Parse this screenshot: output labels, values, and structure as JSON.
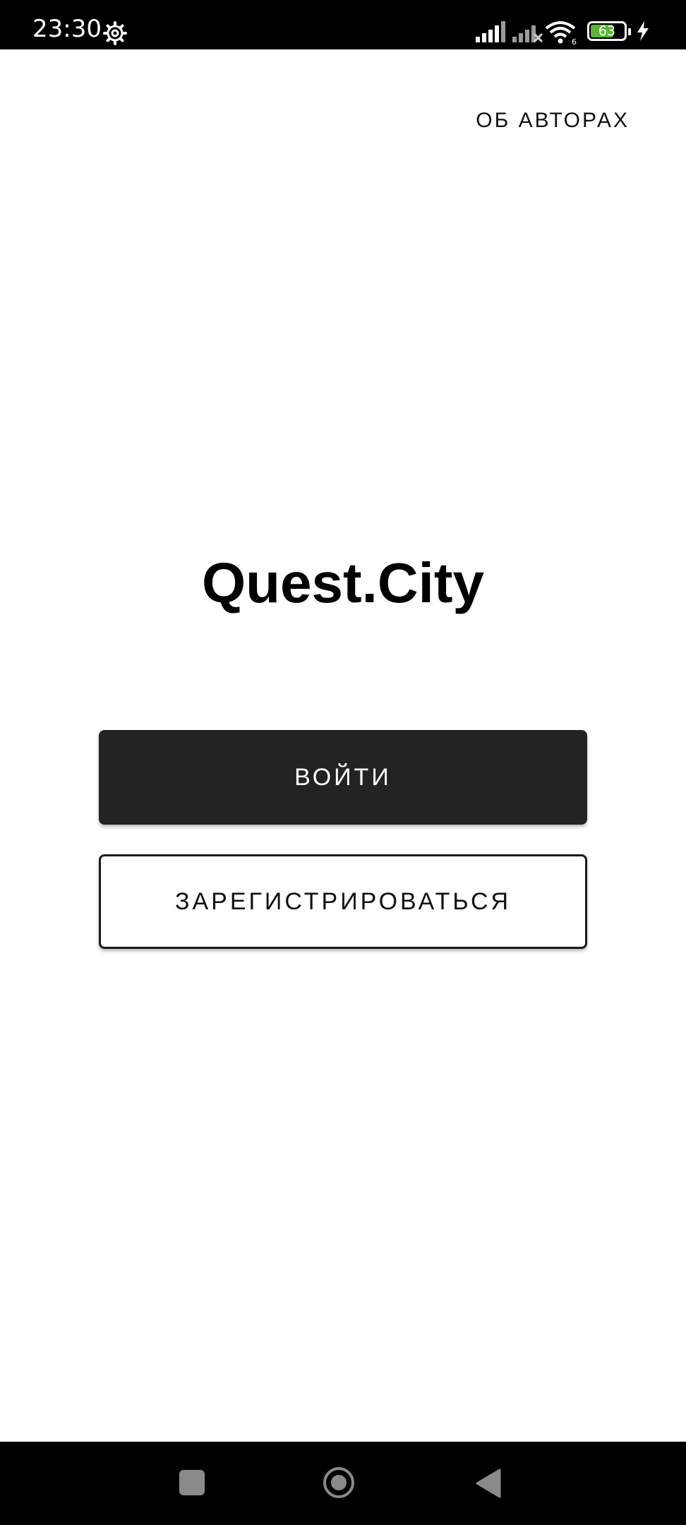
{
  "status_bar": {
    "time": "23:30",
    "battery_level": "63",
    "icons": [
      "gear-icon",
      "signal-icon",
      "signal-no-service-icon",
      "wifi-icon",
      "battery-icon",
      "charging-bolt-icon"
    ]
  },
  "header": {
    "about_label": "ОБ АВТОРАХ"
  },
  "main": {
    "title": "Quest.City",
    "login_label": "ВОЙТИ",
    "register_label": "ЗАРЕГИСТРИРОВАТЬСЯ"
  },
  "nav_bar": {
    "icons": [
      "recents-icon",
      "home-icon",
      "back-icon"
    ]
  },
  "colors": {
    "status_bar_bg": "#000000",
    "primary_button_bg": "#232323",
    "battery_fill": "#59b830",
    "nav_icon": "#8a8a8a"
  }
}
